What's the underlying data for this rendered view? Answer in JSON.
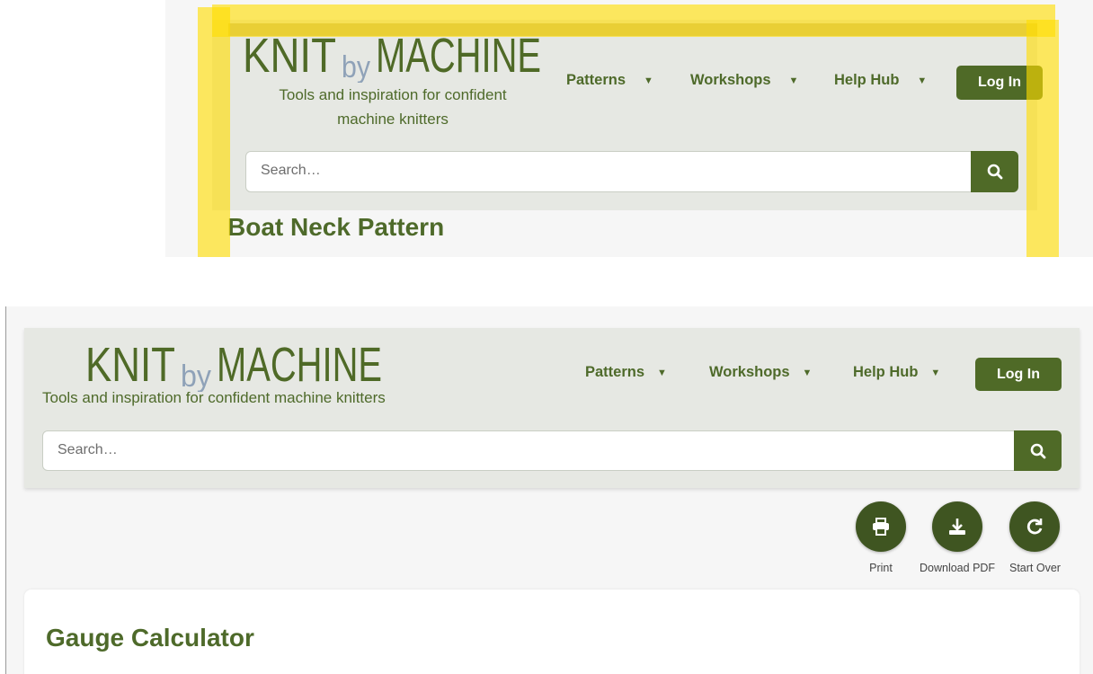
{
  "brand": {
    "logo_knit": "KNIT",
    "logo_by": "by",
    "logo_machine": "MACHINE",
    "tagline": "Tools and inspiration for confident machine knitters",
    "tagline_line1": "Tools and inspiration for confident",
    "tagline_line2": "machine knitters"
  },
  "nav": {
    "items": [
      {
        "label": "Patterns",
        "caret": "▼"
      },
      {
        "label": "Workshops",
        "caret": "▼"
      },
      {
        "label": "Help Hub",
        "caret": "▼"
      }
    ],
    "login_label": "Log In"
  },
  "search": {
    "placeholder": "Search…",
    "button_icon": "search-icon"
  },
  "preview": {
    "page_title": "Boat Neck Pattern",
    "highlight_color": "#ffdd00"
  },
  "actions": [
    {
      "label": "Print",
      "icon": "print-icon"
    },
    {
      "label": "Download PDF",
      "icon": "download-icon"
    },
    {
      "label": "Start Over",
      "icon": "redo-icon"
    }
  ],
  "main": {
    "card_title": "Gauge Calculator"
  },
  "colors": {
    "brand_green": "#4f6a27",
    "text_green": "#4e6a2a",
    "header_bg": "#e6e8e3",
    "action_circle": "#3f5521"
  }
}
